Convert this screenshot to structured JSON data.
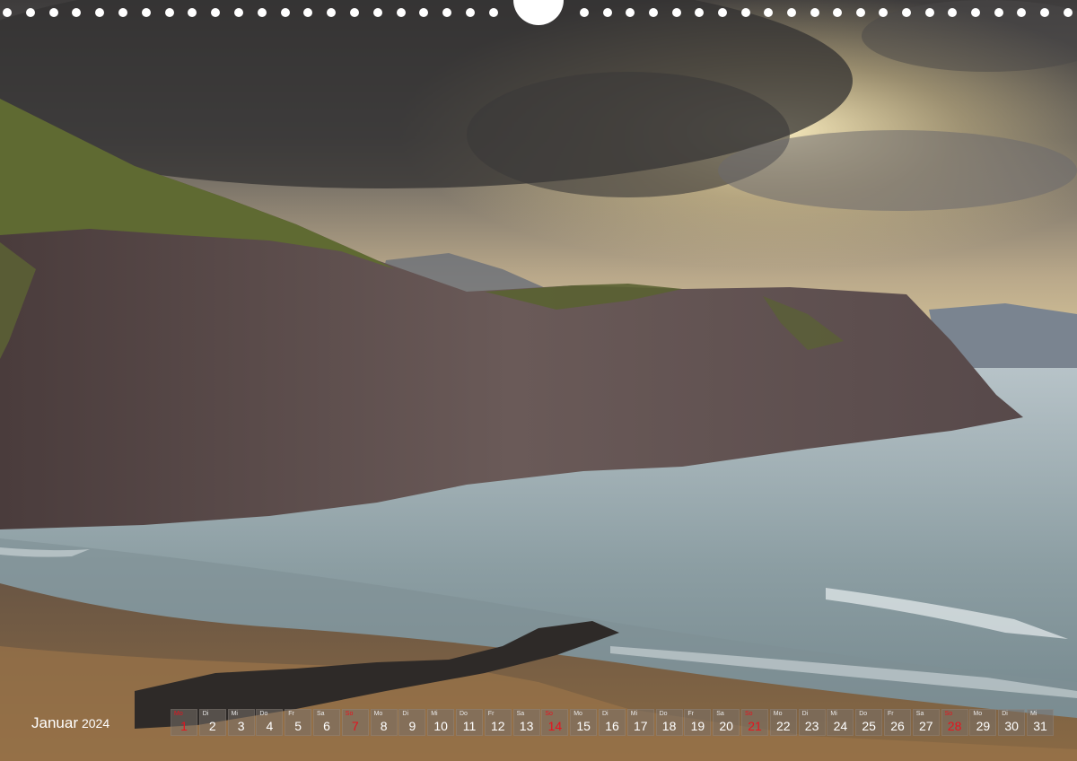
{
  "calendar": {
    "month": "Januar",
    "year": "2024",
    "days": [
      {
        "wd": "Mo",
        "d": "1",
        "red": true
      },
      {
        "wd": "Di",
        "d": "2"
      },
      {
        "wd": "Mi",
        "d": "3"
      },
      {
        "wd": "Do",
        "d": "4"
      },
      {
        "wd": "Fr",
        "d": "5"
      },
      {
        "wd": "Sa",
        "d": "6"
      },
      {
        "wd": "So",
        "d": "7",
        "red": true
      },
      {
        "wd": "Mo",
        "d": "8"
      },
      {
        "wd": "Di",
        "d": "9"
      },
      {
        "wd": "Mi",
        "d": "10"
      },
      {
        "wd": "Do",
        "d": "11"
      },
      {
        "wd": "Fr",
        "d": "12"
      },
      {
        "wd": "Sa",
        "d": "13"
      },
      {
        "wd": "So",
        "d": "14",
        "red": true
      },
      {
        "wd": "Mo",
        "d": "15"
      },
      {
        "wd": "Di",
        "d": "16"
      },
      {
        "wd": "Mi",
        "d": "17"
      },
      {
        "wd": "Do",
        "d": "18"
      },
      {
        "wd": "Fr",
        "d": "19"
      },
      {
        "wd": "Sa",
        "d": "20"
      },
      {
        "wd": "So",
        "d": "21",
        "red": true
      },
      {
        "wd": "Mo",
        "d": "22"
      },
      {
        "wd": "Di",
        "d": "23"
      },
      {
        "wd": "Mi",
        "d": "24"
      },
      {
        "wd": "Do",
        "d": "25"
      },
      {
        "wd": "Fr",
        "d": "26"
      },
      {
        "wd": "Sa",
        "d": "27"
      },
      {
        "wd": "So",
        "d": "28",
        "red": true
      },
      {
        "wd": "Mo",
        "d": "29"
      },
      {
        "wd": "Di",
        "d": "30"
      },
      {
        "wd": "Mi",
        "d": "31"
      }
    ]
  },
  "colors": {
    "holiday": "#e8121e",
    "day_cell": "#787068"
  }
}
